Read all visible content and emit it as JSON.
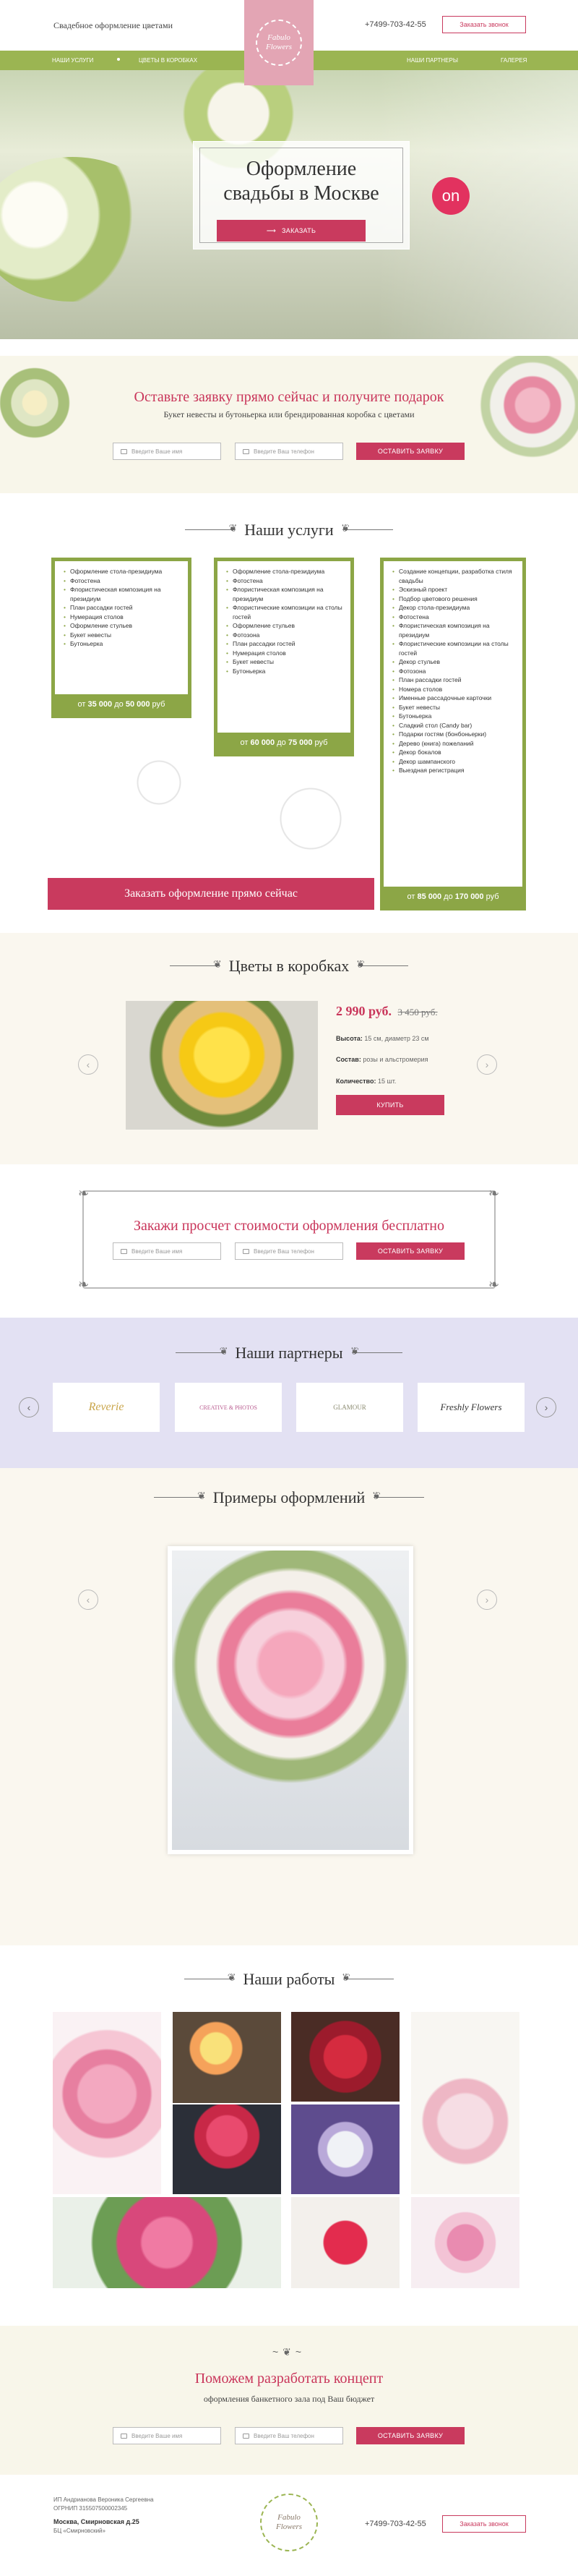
{
  "header": {
    "tagline": "Свадебное оформление цветами",
    "logo_text": "Fabulo Flowers",
    "phone": "+7499-703-42-55",
    "call_button": "Заказать звонок"
  },
  "nav": {
    "items": [
      "НАШИ УСЛУГИ",
      "ЦВЕТЫ В КОРОБКАХ",
      "НАШИ ПАРТНЕРЫ",
      "ГАЛЕРЕЯ"
    ]
  },
  "hero": {
    "title_line1": "Оформление",
    "title_line2": "свадьбы в Москве",
    "button": "ЗАКАЗАТЬ",
    "badge": "on"
  },
  "offer": {
    "title": "Оставьте заявку прямо сейчас и получите подарок",
    "subtitle": "Букет невесты и бутоньерка или брендированная коробка с цветами",
    "name_placeholder": "Введите Ваше имя",
    "phone_placeholder": "Введите Ваш телефон",
    "button": "ОСТАВИТЬ ЗАЯВКУ"
  },
  "services": {
    "title": "Наши услуги",
    "box1": {
      "items": [
        "Оформление стола-президиума",
        "Фотостена",
        "Флористическая композиция на президиум",
        "План рассадки гостей",
        "Нумерация столов",
        "Оформление стульев",
        "Букет невесты",
        "Бутоньерка"
      ],
      "price_prefix": "от",
      "price_from": "35 000",
      "price_mid": "до",
      "price_to": "50 000",
      "price_suffix": "руб"
    },
    "box2": {
      "items": [
        "Оформление стола-президиума",
        "Фотостена",
        "Флористическая композиция на президиум",
        "Флористические композиции на столы гостей",
        "Оформление стульев",
        "Фотозона",
        "План рассадки гостей",
        "Нумерация столов",
        "Букет невесты",
        "Бутоньерка"
      ],
      "price_prefix": "от",
      "price_from": "60 000",
      "price_mid": "до",
      "price_to": "75 000",
      "price_suffix": "руб"
    },
    "box3": {
      "items": [
        "Создание концепции, разработка стиля свадьбы",
        "Эскизный проект",
        "Подбор цветового решения",
        "Декор стола-президиума",
        "Фотостена",
        "Флористическая композиция на президиум",
        "Флористические композиции на столы гостей",
        "Декор стульев",
        "Фотозона",
        "План рассадки гостей",
        "Номера столов",
        "Именные рассадочные карточки",
        "Букет невесты",
        "Бутоньерка",
        "Сладкий стол (Candy bar)",
        "Подарки гостям (бонбоньерки)",
        "Дерево (книга) пожеланий",
        "Декор бокалов",
        "Декор шампанского",
        "Выездная регистрация"
      ],
      "price_prefix": "от",
      "price_from": "85 000",
      "price_mid": "до",
      "price_to": "170 000",
      "price_suffix": "руб"
    },
    "order_button": "Заказать оформление прямо сейчас"
  },
  "boxes": {
    "title": "Цветы в коробках",
    "price": "2 990 руб.",
    "old_price": "3 450 руб.",
    "height_label": "Высота:",
    "height_value": "15 см, диаметр 23 см",
    "composition_label": "Состав:",
    "composition_value": "розы и альстромерия",
    "quantity_label": "Количество:",
    "quantity_value": "15 шт.",
    "buy_button": "КУПИТЬ"
  },
  "calc": {
    "title": "Закажи просчет стоимости оформления бесплатно",
    "name_placeholder": "Введите Ваше имя",
    "phone_placeholder": "Введите Ваш телефон",
    "button": "ОСТАВИТЬ ЗАЯВКУ"
  },
  "partners": {
    "title": "Наши партнеры",
    "logos": [
      "Reverie",
      "CREATIVE & PHOTOS",
      "GLAMOUR",
      "Freshly Flowers"
    ]
  },
  "examples": {
    "title": "Примеры оформлений"
  },
  "works": {
    "title": "Наши работы"
  },
  "concept": {
    "title": "Поможем разработать концепт",
    "subtitle": "оформления банкетного зала под Ваш бюджет",
    "name_placeholder": "Введите Ваше имя",
    "phone_placeholder": "Введите Ваш телефон",
    "button": "ОСТАВИТЬ ЗАЯВКУ"
  },
  "footer": {
    "legal1": "ИП Андрианова Вероника Сергеевна",
    "legal2": "ОГРНИП 315507500002345",
    "address1": "Москва, Смирновская д.25",
    "address2": "БЦ «Смирновский»",
    "logo_text": "Fabulo Flowers",
    "phone": "+7499-703-42-55",
    "call_button": "Заказать звонок"
  },
  "colors": {
    "accent": "#c93a5e",
    "green": "#8ca646",
    "partners_bg": "#e3e1f3",
    "cream": "#faf7ef"
  }
}
